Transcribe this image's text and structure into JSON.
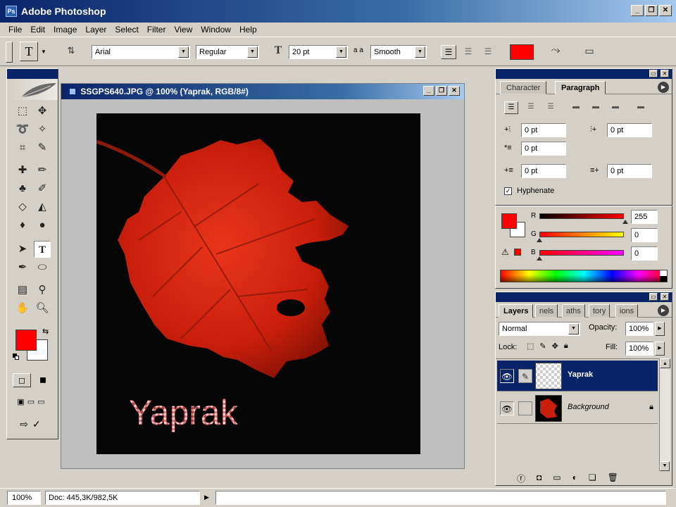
{
  "app": {
    "title": "Adobe Photoshop",
    "icon_text": "Ps"
  },
  "window_controls": {
    "minimize": "_",
    "restore": "❐",
    "close": "✕"
  },
  "menu": [
    "File",
    "Edit",
    "Image",
    "Layer",
    "Select",
    "Filter",
    "View",
    "Window",
    "Help"
  ],
  "options": {
    "tool_glyph": "T",
    "font_family": "Arial",
    "font_style": "Regular",
    "font_size": "20 pt",
    "aa_label": "a a",
    "antialias": "Smooth",
    "text_color": "#ff0000"
  },
  "document": {
    "title": "SSGPS640.JPG @ 100% (Yaprak, RGB/8#)",
    "text_layer_content": "Yaprak",
    "leaf_color": "#d0200c"
  },
  "toolbox": {
    "foreground": "#ff0000",
    "background": "#ffffff"
  },
  "paragraph_panel": {
    "tabs": [
      "Character",
      "Paragraph"
    ],
    "active_tab": "Paragraph",
    "indent_left": "0 pt",
    "indent_right": "0 pt",
    "indent_first": "0 pt",
    "space_before": "0 pt",
    "space_after": "0 pt",
    "hyphenate_label": "Hyphenate",
    "hyphenate_checked": true
  },
  "color_panel": {
    "r_label": "R",
    "g_label": "G",
    "b_label": "B",
    "r": "255",
    "g": "0",
    "b": "0"
  },
  "layers_panel": {
    "tabs": [
      "Layers",
      "nels",
      "aths",
      "tory",
      "ions"
    ],
    "blend_mode": "Normal",
    "opacity_label": "Opacity:",
    "opacity": "100%",
    "lock_label": "Lock:",
    "fill_label": "Fill:",
    "fill": "100%",
    "layers": [
      {
        "name": "Yaprak",
        "selected": true
      },
      {
        "name": "Background",
        "selected": false
      }
    ]
  },
  "status": {
    "zoom": "100%",
    "doc_info": "Doc: 445,3K/982,5K"
  }
}
